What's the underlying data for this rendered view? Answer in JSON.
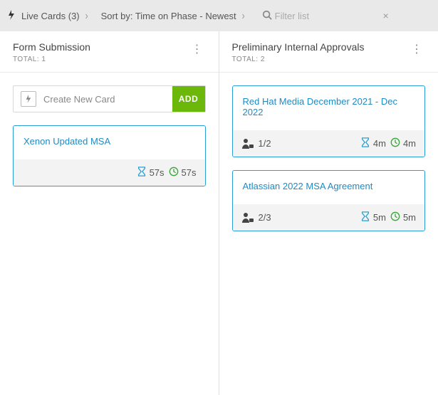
{
  "toolbar": {
    "live_cards_label": "Live Cards (3)",
    "sort_label": "Sort by: Time on Phase - Newest",
    "filter_placeholder": "Filter list"
  },
  "columns": [
    {
      "title": "Form Submission",
      "total_label": "TOTAL: 1",
      "create": {
        "label": "Create New Card",
        "button": "ADD"
      },
      "cards": [
        {
          "title": "Xenon Updated MSA",
          "assignee_ratio": "",
          "phase_time": "57s",
          "total_time": "57s"
        }
      ]
    },
    {
      "title": "Preliminary Internal Approvals",
      "total_label": "TOTAL: 2",
      "cards": [
        {
          "title": "Red Hat Media December 2021 - Dec 2022",
          "assignee_ratio": "1/2",
          "phase_time": "4m",
          "total_time": "4m"
        },
        {
          "title": "Atlassian 2022 MSA Agreement",
          "assignee_ratio": "2/3",
          "phase_time": "5m",
          "total_time": "5m"
        }
      ]
    }
  ]
}
